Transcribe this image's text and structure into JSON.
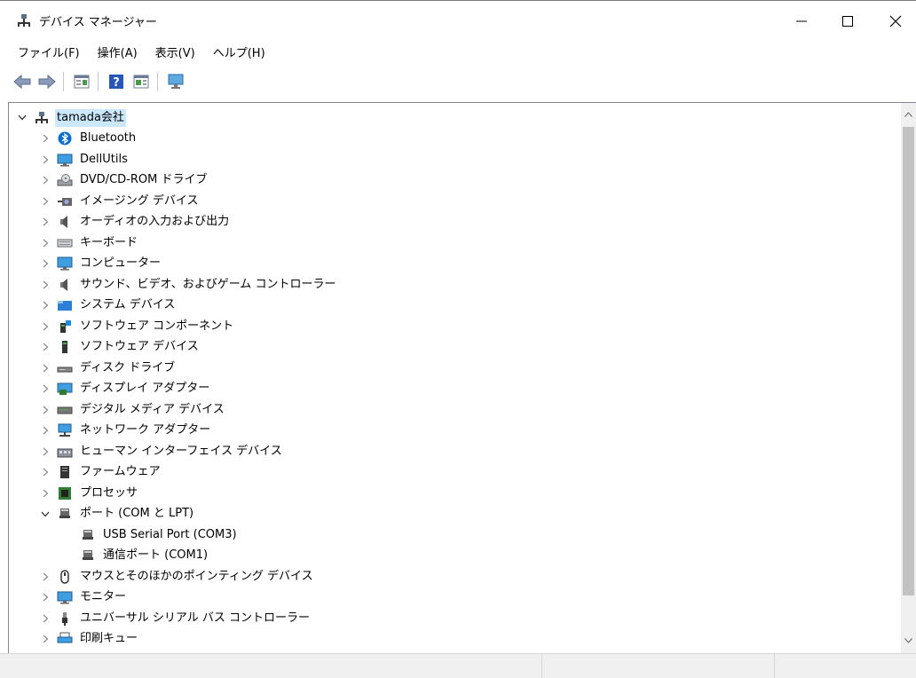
{
  "window": {
    "title": "デバイス マネージャー",
    "minimize_glyph": "—",
    "maximize_glyph": "☐",
    "close_glyph": "✕"
  },
  "menu": [
    {
      "label": "ファイル(F)"
    },
    {
      "label": "操作(A)"
    },
    {
      "label": "表示(V)"
    },
    {
      "label": "ヘルプ(H)"
    }
  ],
  "toolbar": {
    "buttons": [
      "back-icon",
      "forward-icon",
      "properties-icon",
      "help-icon",
      "update-driver-icon",
      "scan-hardware-icon"
    ]
  },
  "tree": {
    "root": {
      "label": "tamada会社",
      "icon": "computer-network-icon",
      "expanded": true
    },
    "items": [
      {
        "label": "Bluetooth",
        "icon": "bluetooth-icon",
        "expanded": false
      },
      {
        "label": "DellUtils",
        "icon": "monitor-icon",
        "expanded": false
      },
      {
        "label": "DVD/CD-ROM ドライブ",
        "icon": "dvd-drive-icon",
        "expanded": false
      },
      {
        "label": "イメージング デバイス",
        "icon": "camera-icon",
        "expanded": false
      },
      {
        "label": "オーディオの入力および出力",
        "icon": "speaker-icon",
        "expanded": false
      },
      {
        "label": "キーボード",
        "icon": "keyboard-icon",
        "expanded": false
      },
      {
        "label": "コンピューター",
        "icon": "computer-icon",
        "expanded": false
      },
      {
        "label": "サウンド、ビデオ、およびゲーム コントローラー",
        "icon": "speaker-icon",
        "expanded": false
      },
      {
        "label": "システム デバイス",
        "icon": "system-folder-icon",
        "expanded": false
      },
      {
        "label": "ソフトウェア コンポーネント",
        "icon": "software-component-icon",
        "expanded": false
      },
      {
        "label": "ソフトウェア デバイス",
        "icon": "software-device-icon",
        "expanded": false
      },
      {
        "label": "ディスク ドライブ",
        "icon": "disk-drive-icon",
        "expanded": false
      },
      {
        "label": "ディスプレイ アダプター",
        "icon": "display-adapter-icon",
        "expanded": false
      },
      {
        "label": "デジタル メディア デバイス",
        "icon": "media-device-icon",
        "expanded": false
      },
      {
        "label": "ネットワーク アダプター",
        "icon": "network-adapter-icon",
        "expanded": false
      },
      {
        "label": "ヒューマン インターフェイス デバイス",
        "icon": "hid-icon",
        "expanded": false
      },
      {
        "label": "ファームウェア",
        "icon": "firmware-icon",
        "expanded": false
      },
      {
        "label": "プロセッサ",
        "icon": "processor-icon",
        "expanded": false
      },
      {
        "label": "ポート (COM と LPT)",
        "icon": "port-icon",
        "expanded": true,
        "children": [
          {
            "label": "USB Serial Port (COM3)",
            "icon": "port-icon"
          },
          {
            "label": "通信ポート (COM1)",
            "icon": "port-icon"
          }
        ]
      },
      {
        "label": "マウスとそのほかのポインティング デバイス",
        "icon": "mouse-icon",
        "expanded": false
      },
      {
        "label": "モニター",
        "icon": "monitor-icon",
        "expanded": false
      },
      {
        "label": "ユニバーサル シリアル バス コントローラー",
        "icon": "usb-icon",
        "expanded": false
      },
      {
        "label": "印刷キュー",
        "icon": "printer-icon",
        "expanded": false
      }
    ]
  },
  "colors": {
    "selection": "#cce8ff",
    "accent_blue": "#0078d7",
    "scroll_thumb": "#c2c2c2"
  }
}
